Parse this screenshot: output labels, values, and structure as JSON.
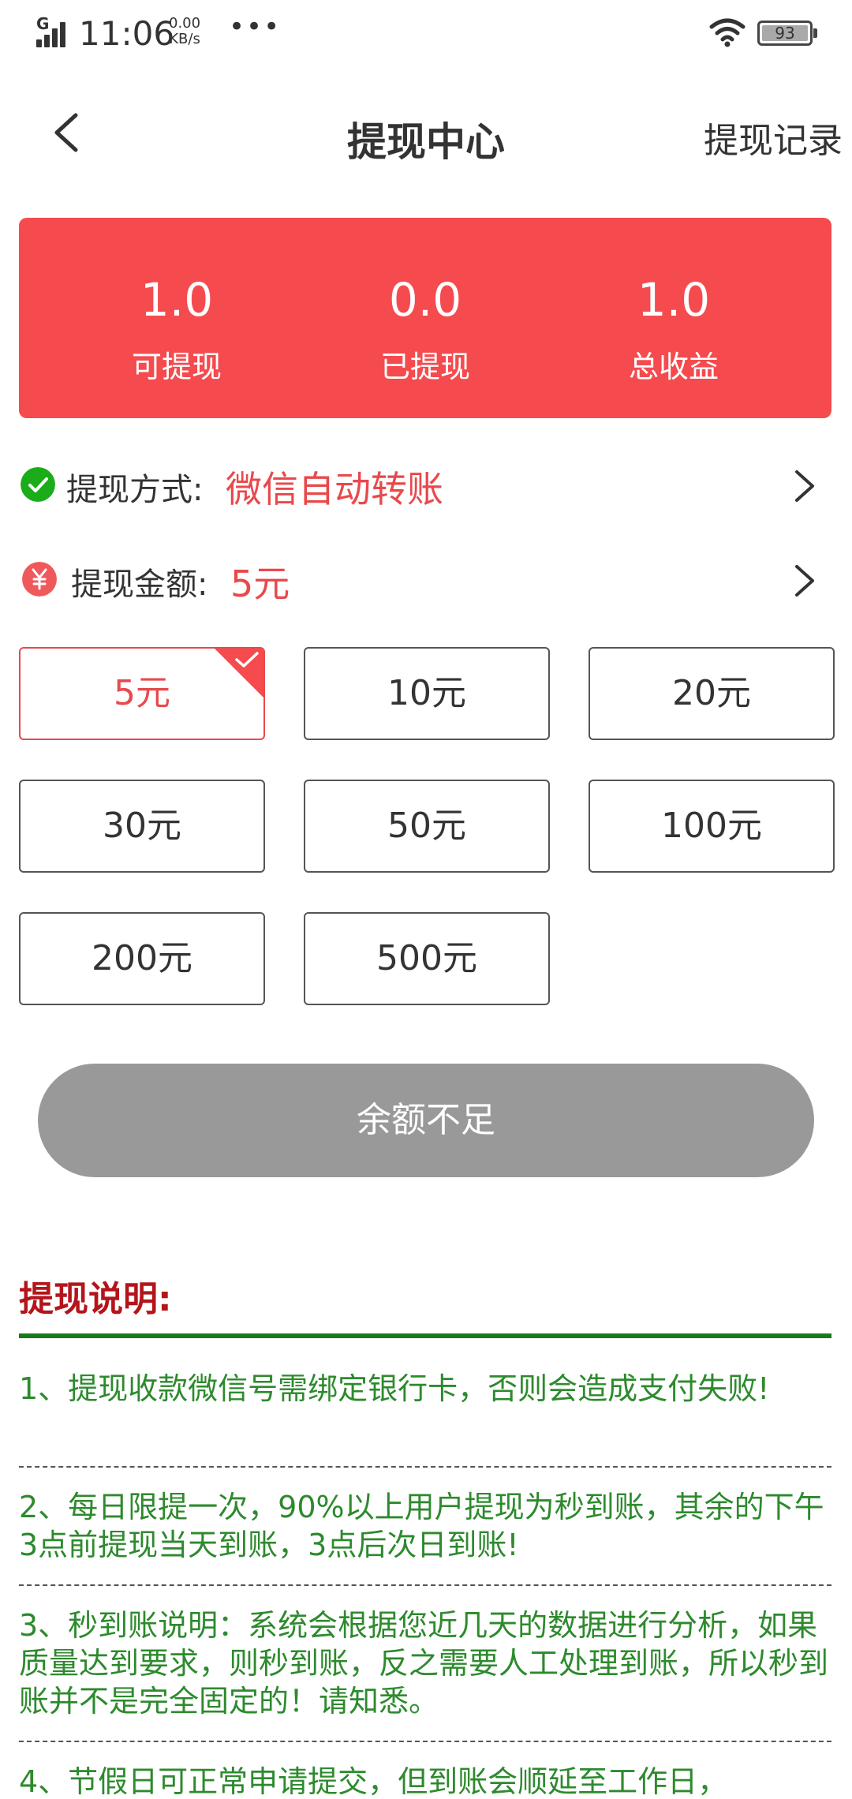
{
  "status_bar": {
    "network": "G",
    "time": "11:06",
    "speed_value": "0.00",
    "speed_unit": "KB/s",
    "more": "•••",
    "battery": "93"
  },
  "nav": {
    "title": "提现中心",
    "records_link": "提现记录"
  },
  "stats": [
    {
      "value": "1.0",
      "label": "可提现"
    },
    {
      "value": "0.0",
      "label": "已提现"
    },
    {
      "value": "1.0",
      "label": "总收益"
    }
  ],
  "withdraw_method": {
    "label": "提现方式:",
    "value": "微信自动转账"
  },
  "withdraw_amount": {
    "label": "提现金额:",
    "value": "5元"
  },
  "amount_options": [
    "5元",
    "10元",
    "20元",
    "30元",
    "50元",
    "100元",
    "200元",
    "500元"
  ],
  "selected_amount_index": 0,
  "submit_button": "余额不足",
  "description": {
    "title": "提现说明:",
    "items": [
      "1、提现收款微信号需绑定银行卡，否则会造成支付失败!",
      "2、每日限提一次，90%以上用户提现为秒到账，其余的下午3点前提现当天到账，3点后次日到账!",
      "3、秒到账说明：系统会根据您近几天的数据进行分析，如果质量达到要求，则秒到账，反之需要人工处理到账，所以秒到账并不是完全固定的！请知悉。",
      "4、节假日可正常申请提交，但到账会顺延至工作日，"
    ]
  },
  "colors": {
    "primary_red": "#f54b4f",
    "text_red": "#e8494c",
    "title_red": "#b3151b",
    "green": "#2d8a2d",
    "button_gray": "#999999"
  },
  "icons": {
    "method": "wechat-icon",
    "amount": "yuan-icon"
  }
}
